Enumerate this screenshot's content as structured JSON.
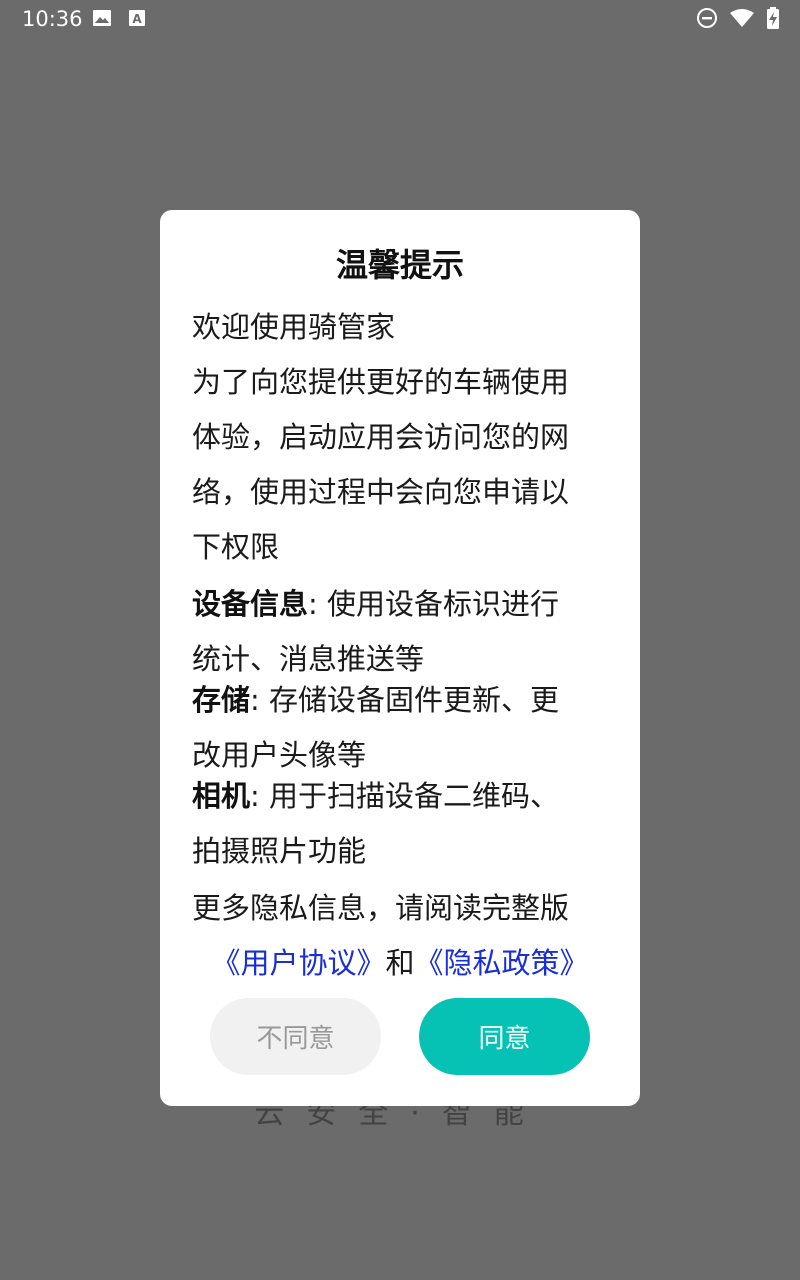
{
  "status_bar": {
    "time": "10:36",
    "left_icons": [
      "image-icon",
      "font-a-icon"
    ],
    "right_icons": [
      "do-not-disturb-icon",
      "wifi-icon",
      "battery-charging-icon"
    ]
  },
  "background": {
    "slogan": "云安全·智能"
  },
  "dialog": {
    "title": "温馨提示",
    "welcome": "欢迎使用骑管家",
    "intro_lines": [
      "为了向您提供更好的车辆使用",
      "体验，启动应用会访问您的网",
      "络，使用过程中会向您申请以",
      "下权限"
    ],
    "permissions": [
      {
        "name": "设备信息",
        "desc_line1": ": 使用设备标识进行",
        "desc_line2": "统计、消息推送等"
      },
      {
        "name": "存储",
        "desc_line1": ": 存储设备固件更新、更",
        "desc_line2": "改用户头像等"
      },
      {
        "name": "相机",
        "desc_line1": ": 用于扫描设备二维码、",
        "desc_line2": "拍摄照片功能"
      }
    ],
    "more_info": "更多隐私信息，请阅读完整版",
    "user_agreement_link": "《用户协议》",
    "and_text": "和",
    "privacy_policy_link": "《隐私政策》",
    "disagree_label": "不同意",
    "agree_label": "同意"
  },
  "colors": {
    "overlay": "#6b6b6b",
    "accent": "#05c2b4",
    "link": "#1a2ed8",
    "disagree_bg": "#f1f1f1"
  }
}
